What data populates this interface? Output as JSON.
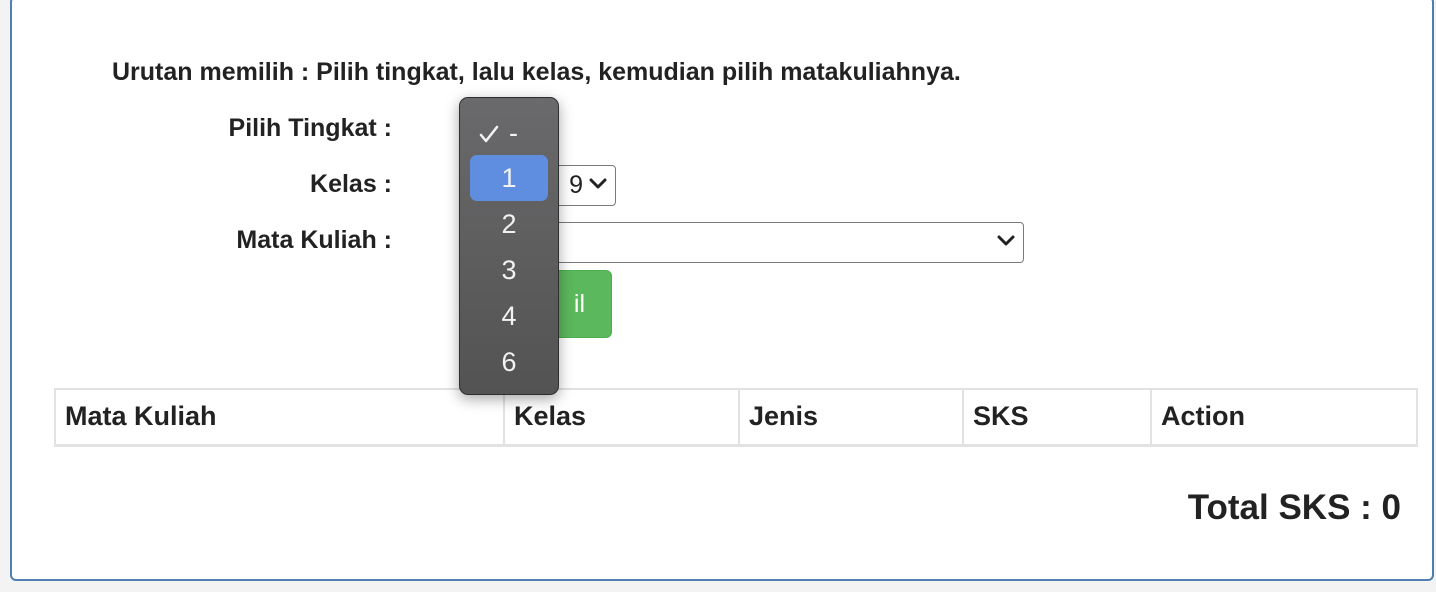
{
  "instruction": "Urutan memilih : Pilih tingkat, lalu kelas, kemudian pilih matakuliahnya.",
  "form": {
    "tingkat_label": "Pilih Tingkat  :",
    "kelas_label": "Kelas  :",
    "matkul_label": "Mata Kuliah  :",
    "kelas_visible_value": "9",
    "matkul_value": "",
    "button_visible_text": "il"
  },
  "dropdown": {
    "selected": "-",
    "highlighted": "1",
    "options": [
      "-",
      "1",
      "2",
      "3",
      "4",
      "6"
    ]
  },
  "table": {
    "headers": [
      "Mata Kuliah",
      "Kelas",
      "Jenis",
      "SKS",
      "Action"
    ]
  },
  "total_label": "Total SKS : 0",
  "colors": {
    "button_green": "#5cb85c",
    "panel_border": "#4f7fb0",
    "dropdown_highlight": "#5f8ee0"
  },
  "icons": {
    "chevron": "chevron-down-icon",
    "check": "checkmark-icon"
  }
}
